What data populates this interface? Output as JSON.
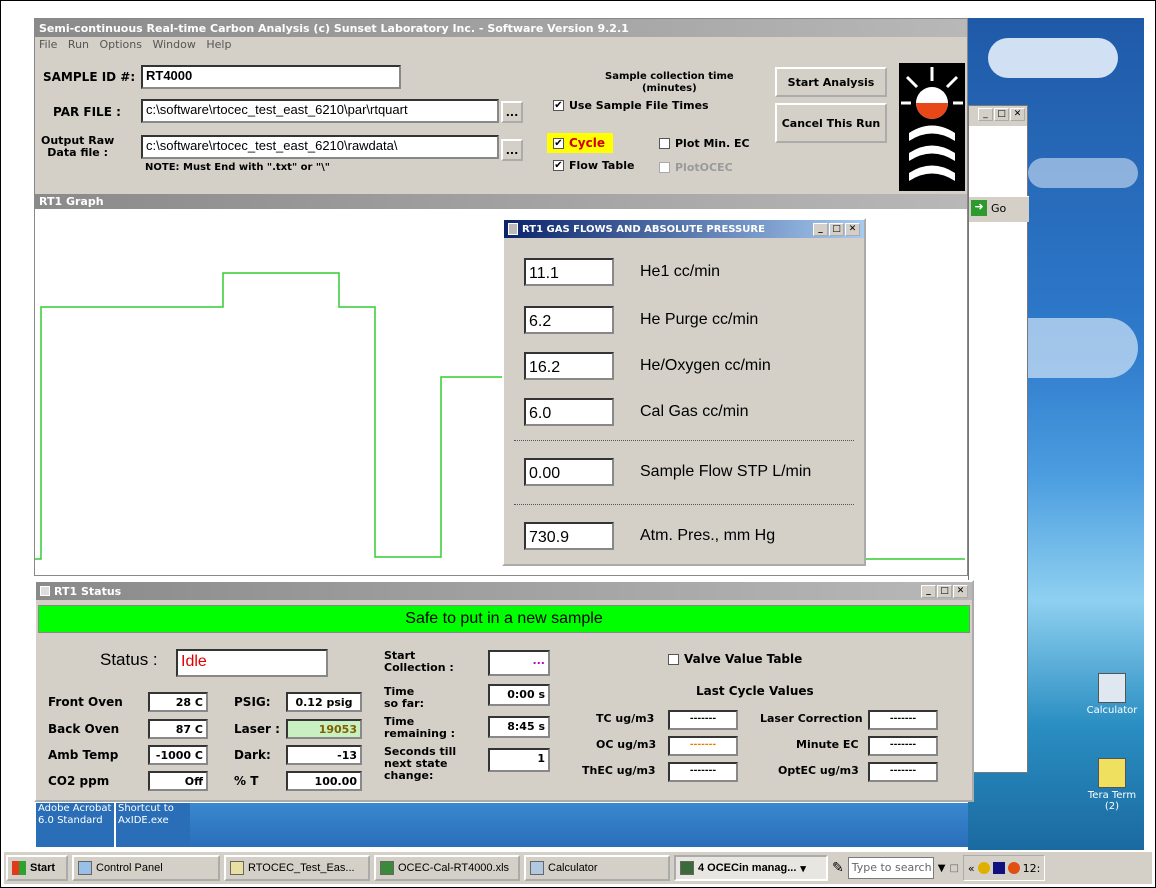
{
  "main_window": {
    "title": "Semi-continuous Real-time Carbon Analysis (c) Sunset Laboratory Inc. - Software Version 9.2.1",
    "menu": [
      "File",
      "Run",
      "Options",
      "Window",
      "Help"
    ],
    "sample_id_label": "SAMPLE ID #:",
    "sample_id_value": "RT4000",
    "par_file_label": "PAR FILE :",
    "par_file_value": "c:\\software\\rtocec_test_east_6210\\par\\rtquart",
    "output_label_1": "Output Raw",
    "output_label_2": "Data file :",
    "output_value": "c:\\software\\rtocec_test_east_6210\\rawdata\\",
    "browse_label": "...",
    "note": "NOTE: Must End with \".txt\" or \"\\\"",
    "collection_time_label_1": "Sample collection time",
    "collection_time_label_2": "(minutes)",
    "chk_use_sample_file_times": "Use Sample File Times",
    "chk_cycle": "Cycle",
    "chk_plot_min_ec": "Plot Min. EC",
    "chk_flow_table": "Flow Table",
    "chk_plot_ocec": "PlotOCEC",
    "check_mark": "✔",
    "start_analysis": "Start Analysis",
    "cancel_run": "Cancel This Run",
    "graph_title": "RT1 Graph"
  },
  "flows_window": {
    "title": "RT1 GAS FLOWS AND ABSOLUTE PRESSURE",
    "rows": [
      {
        "value": "11.1",
        "label": "He1 cc/min"
      },
      {
        "value": "6.2",
        "label": "He Purge cc/min"
      },
      {
        "value": "16.2",
        "label": "He/Oxygen cc/min"
      },
      {
        "value": "6.0",
        "label": "Cal Gas cc/min"
      },
      {
        "value": "0.00",
        "label": "Sample Flow STP L/min"
      },
      {
        "value": "730.9",
        "label": "Atm. Pres., mm Hg"
      }
    ]
  },
  "status_window": {
    "title": "RT1 Status",
    "banner": "Safe to put in a new sample",
    "status_label": "Status :",
    "status_value": "Idle",
    "front_oven_label": "Front Oven",
    "front_oven_value": "28 C",
    "back_oven_label": "Back Oven",
    "back_oven_value": "87 C",
    "amb_temp_label": "Amb Temp",
    "amb_temp_value": "-1000 C",
    "co2_label": "CO2 ppm",
    "co2_value": "Off",
    "psig_label": "PSIG:",
    "psig_value": "0.12 psig",
    "laser_label": "Laser :",
    "laser_value": "19053",
    "dark_label": "Dark:",
    "dark_value": "-13",
    "pct_t_label": "% T",
    "pct_t_value": "100.00",
    "start_collection_label_1": "Start",
    "start_collection_label_2": "Collection :",
    "start_collection_value": "...",
    "time_so_far_label_1": "Time",
    "time_so_far_label_2": "so far:",
    "time_so_far_value": "0:00 s",
    "time_remaining_label_1": "Time",
    "time_remaining_label_2": "remaining :",
    "time_remaining_value": "8:45 s",
    "seconds_till_label_1": "Seconds till",
    "seconds_till_label_2": "next state",
    "seconds_till_label_3": "change:",
    "seconds_till_value": "1",
    "valve_table": "Valve Value Table",
    "last_cycle_title": "Last Cycle Values",
    "tc_label": "TC ug/m3",
    "oc_label": "OC ug/m3",
    "thec_label": "ThEC ug/m3",
    "laser_corr_label": "Laser Correction",
    "minute_ec_label": "Minute EC",
    "optec_label": "OptEC ug/m3",
    "empty_value": "-------"
  },
  "desktop": {
    "icon_calculator": "Calculator",
    "icon_tera_1": "Tera Term",
    "icon_tera_2": "(2)",
    "shortcut_acrobat_1": "Adobe Acrobat",
    "shortcut_acrobat_2": "6.0 Standard",
    "shortcut_axide_1": "Shortcut to",
    "shortcut_axide_2": "AxIDE.exe",
    "go_label": "Go"
  },
  "taskbar": {
    "start": "Start",
    "items": [
      "Control Panel",
      "RTOCEC_Test_Eas...",
      "OCEC-Cal-RT4000.xls",
      "Calculator",
      "4 OCECin manag..."
    ],
    "search_placeholder": "Type to search",
    "clock": "12:"
  },
  "colors": {
    "banner": "#00ff00",
    "status_idle": "#ff0000",
    "cycle_highlight": "#ffff00",
    "laser_box": "#c8f0c0",
    "graph_line": "#33cc33"
  }
}
